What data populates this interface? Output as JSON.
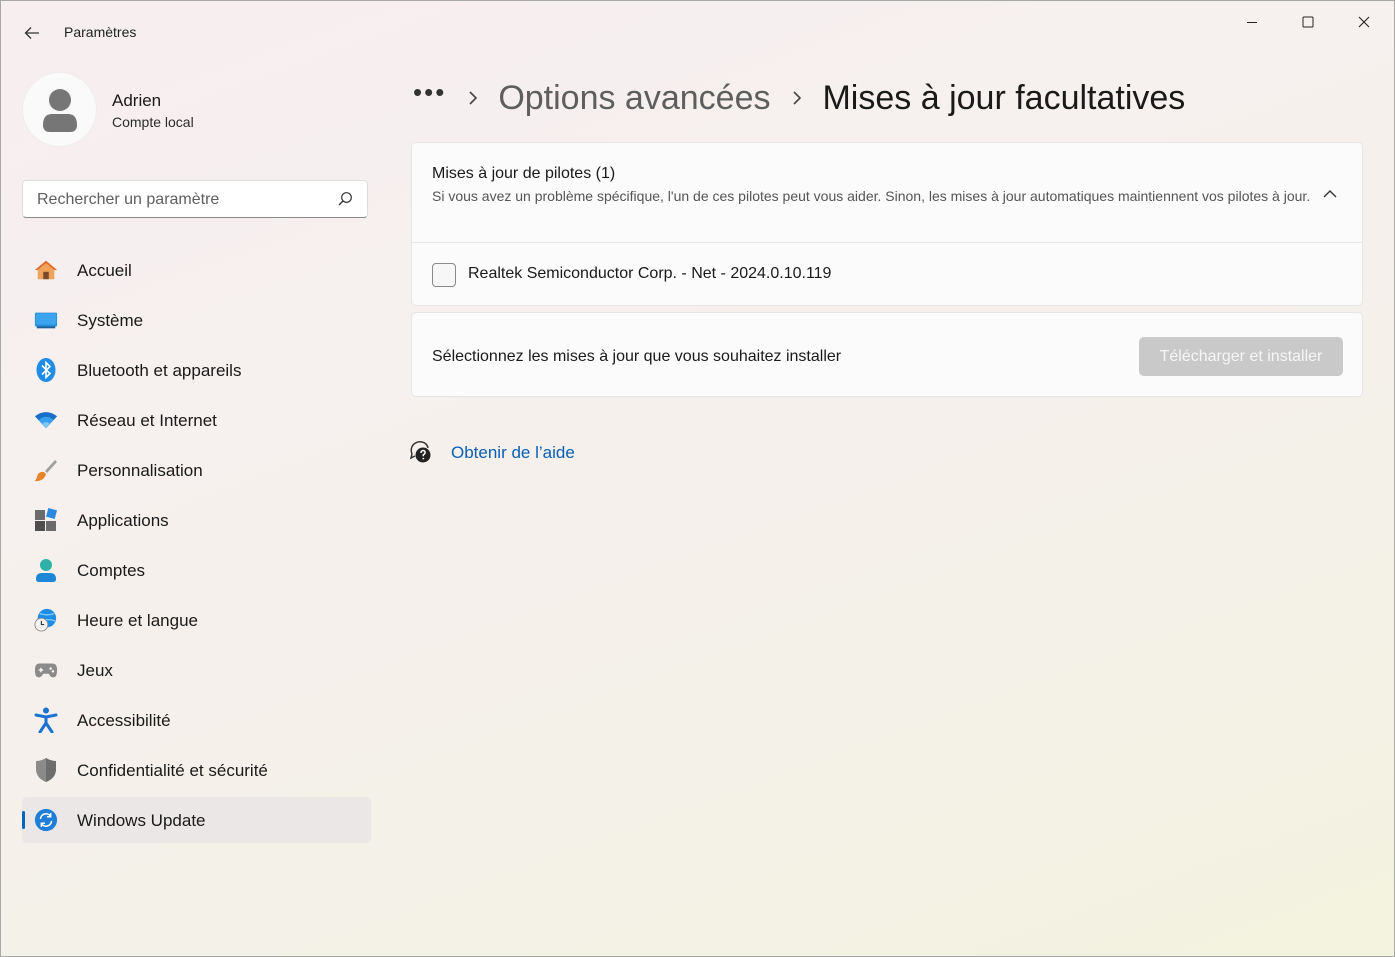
{
  "app": {
    "title": "Paramètres"
  },
  "user": {
    "name": "Adrien",
    "account_type": "Compte local"
  },
  "search": {
    "placeholder": "Rechercher un paramètre"
  },
  "sidebar": {
    "items": [
      {
        "label": "Accueil",
        "icon": "home-icon"
      },
      {
        "label": "Système",
        "icon": "display-icon"
      },
      {
        "label": "Bluetooth et appareils",
        "icon": "bluetooth-icon"
      },
      {
        "label": "Réseau et Internet",
        "icon": "wifi-icon"
      },
      {
        "label": "Personnalisation",
        "icon": "paintbrush-icon"
      },
      {
        "label": "Applications",
        "icon": "apps-icon"
      },
      {
        "label": "Comptes",
        "icon": "person-icon"
      },
      {
        "label": "Heure et langue",
        "icon": "globe-clock-icon"
      },
      {
        "label": "Jeux",
        "icon": "gamepad-icon"
      },
      {
        "label": "Accessibilité",
        "icon": "accessibility-icon"
      },
      {
        "label": "Confidentialité et sécurité",
        "icon": "shield-icon"
      },
      {
        "label": "Windows Update",
        "icon": "update-icon",
        "active": true
      }
    ]
  },
  "breadcrumb": {
    "overflow": "•••",
    "parent": "Options avancées",
    "current": "Mises à jour facultatives"
  },
  "drivers": {
    "title": "Mises à jour de pilotes (1)",
    "description": "Si vous avez un problème spécifique, l'un de ces pilotes peut vous aider. Sinon, les mises à jour automatiques maintiennent vos pilotes à jour.",
    "items": [
      {
        "label": "Realtek Semiconductor Corp. - Net - 2024.0.10.119",
        "checked": false
      }
    ]
  },
  "install": {
    "prompt": "Sélectionnez les mises à jour que vous souhaitez installer",
    "button_label": "Télécharger et installer",
    "button_enabled": false
  },
  "help": {
    "link_label": "Obtenir de l’aide"
  },
  "colors": {
    "accent": "#0067c0",
    "link": "#0a5fb4",
    "disabled_button": "#c9c9c9"
  }
}
